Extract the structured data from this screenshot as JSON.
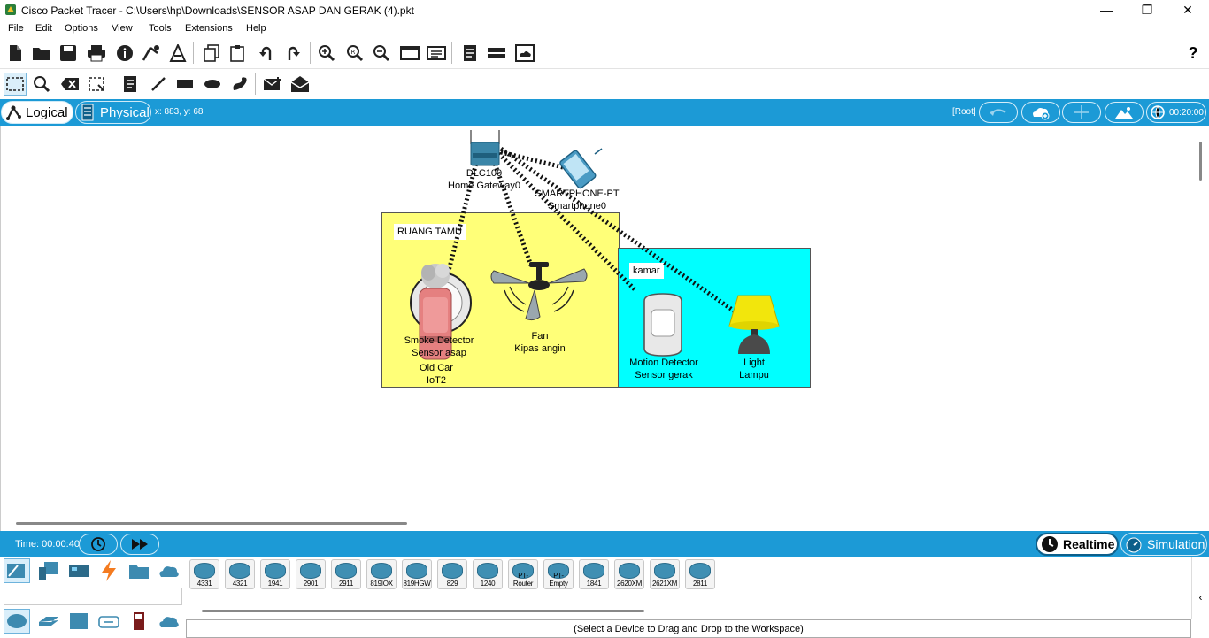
{
  "window": {
    "title": "Cisco Packet Tracer - C:\\Users\\hp\\Downloads\\SENSOR ASAP DAN GERAK (4).pkt",
    "minimize": "—",
    "maximize": "❐",
    "close": "✕"
  },
  "menu": [
    "File",
    "Edit",
    "Options",
    "View",
    "Tools",
    "Extensions",
    "Help"
  ],
  "toolbar_help": "?",
  "tabs": {
    "logical": "Logical",
    "physical": "Physical"
  },
  "cursor_readout": "x: 883, y: 68",
  "root_label": "[Root]",
  "clock": "00:20:00",
  "rooms": [
    {
      "label": "RUANG TAMU",
      "color": "#ffff78"
    },
    {
      "label": "kamar",
      "color": "#00ffff"
    }
  ],
  "devices": {
    "gateway": {
      "model": "DLC100",
      "name": "Home Gateway0"
    },
    "smartphone": {
      "model": "SMARTPHONE-PT",
      "name": "Smartphone0"
    },
    "smoke": {
      "model": "Smoke Detector",
      "name": "Sensor asap"
    },
    "oldcar": {
      "model": "Old Car",
      "name": "IoT2"
    },
    "fan": {
      "model": "Fan",
      "name": "Kipas angin"
    },
    "motion": {
      "model": "Motion Detector",
      "name": "Sensor gerak"
    },
    "light": {
      "model": "Light",
      "name": "Lampu"
    }
  },
  "time_label": "Time: 00:00:40",
  "mode_realtime": "Realtime",
  "mode_simulation": "Simulation",
  "router_models": [
    "4331",
    "4321",
    "1941",
    "2901",
    "2911",
    "819IOX",
    "819HGW",
    "829",
    "1240",
    "PT-Router",
    "PT-Empty",
    "1841",
    "2620XM",
    "2621XM",
    "2811"
  ],
  "status_hint": "(Select a Device to Drag and Drop to the Workspace)",
  "colors": {
    "accent": "#1c9ad6",
    "room_living": "#ffff78",
    "room_bedroom": "#00ffff"
  }
}
